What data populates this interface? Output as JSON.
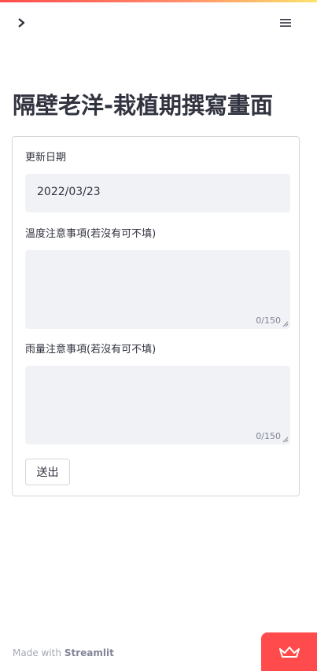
{
  "app": {
    "title": "隔壁老洋-栽植期撰寫畫面",
    "accent_color": "#ff4b4b"
  },
  "header": {
    "collapse_icon": "chevron-right-icon",
    "menu_icon": "hamburger-menu-icon"
  },
  "form": {
    "date_label": "更新日期",
    "date_value": "2022/03/23",
    "temp_label": "溫度注意事項(若沒有可不填)",
    "temp_counter": "0/150",
    "rain_label": "雨量注意事項(若沒有可不填)",
    "rain_counter": "0/150",
    "submit_label": "送出"
  },
  "footer": {
    "made_with": "Made with",
    "brand": "Streamlit",
    "badge_icon": "streamlit-crown-icon"
  }
}
